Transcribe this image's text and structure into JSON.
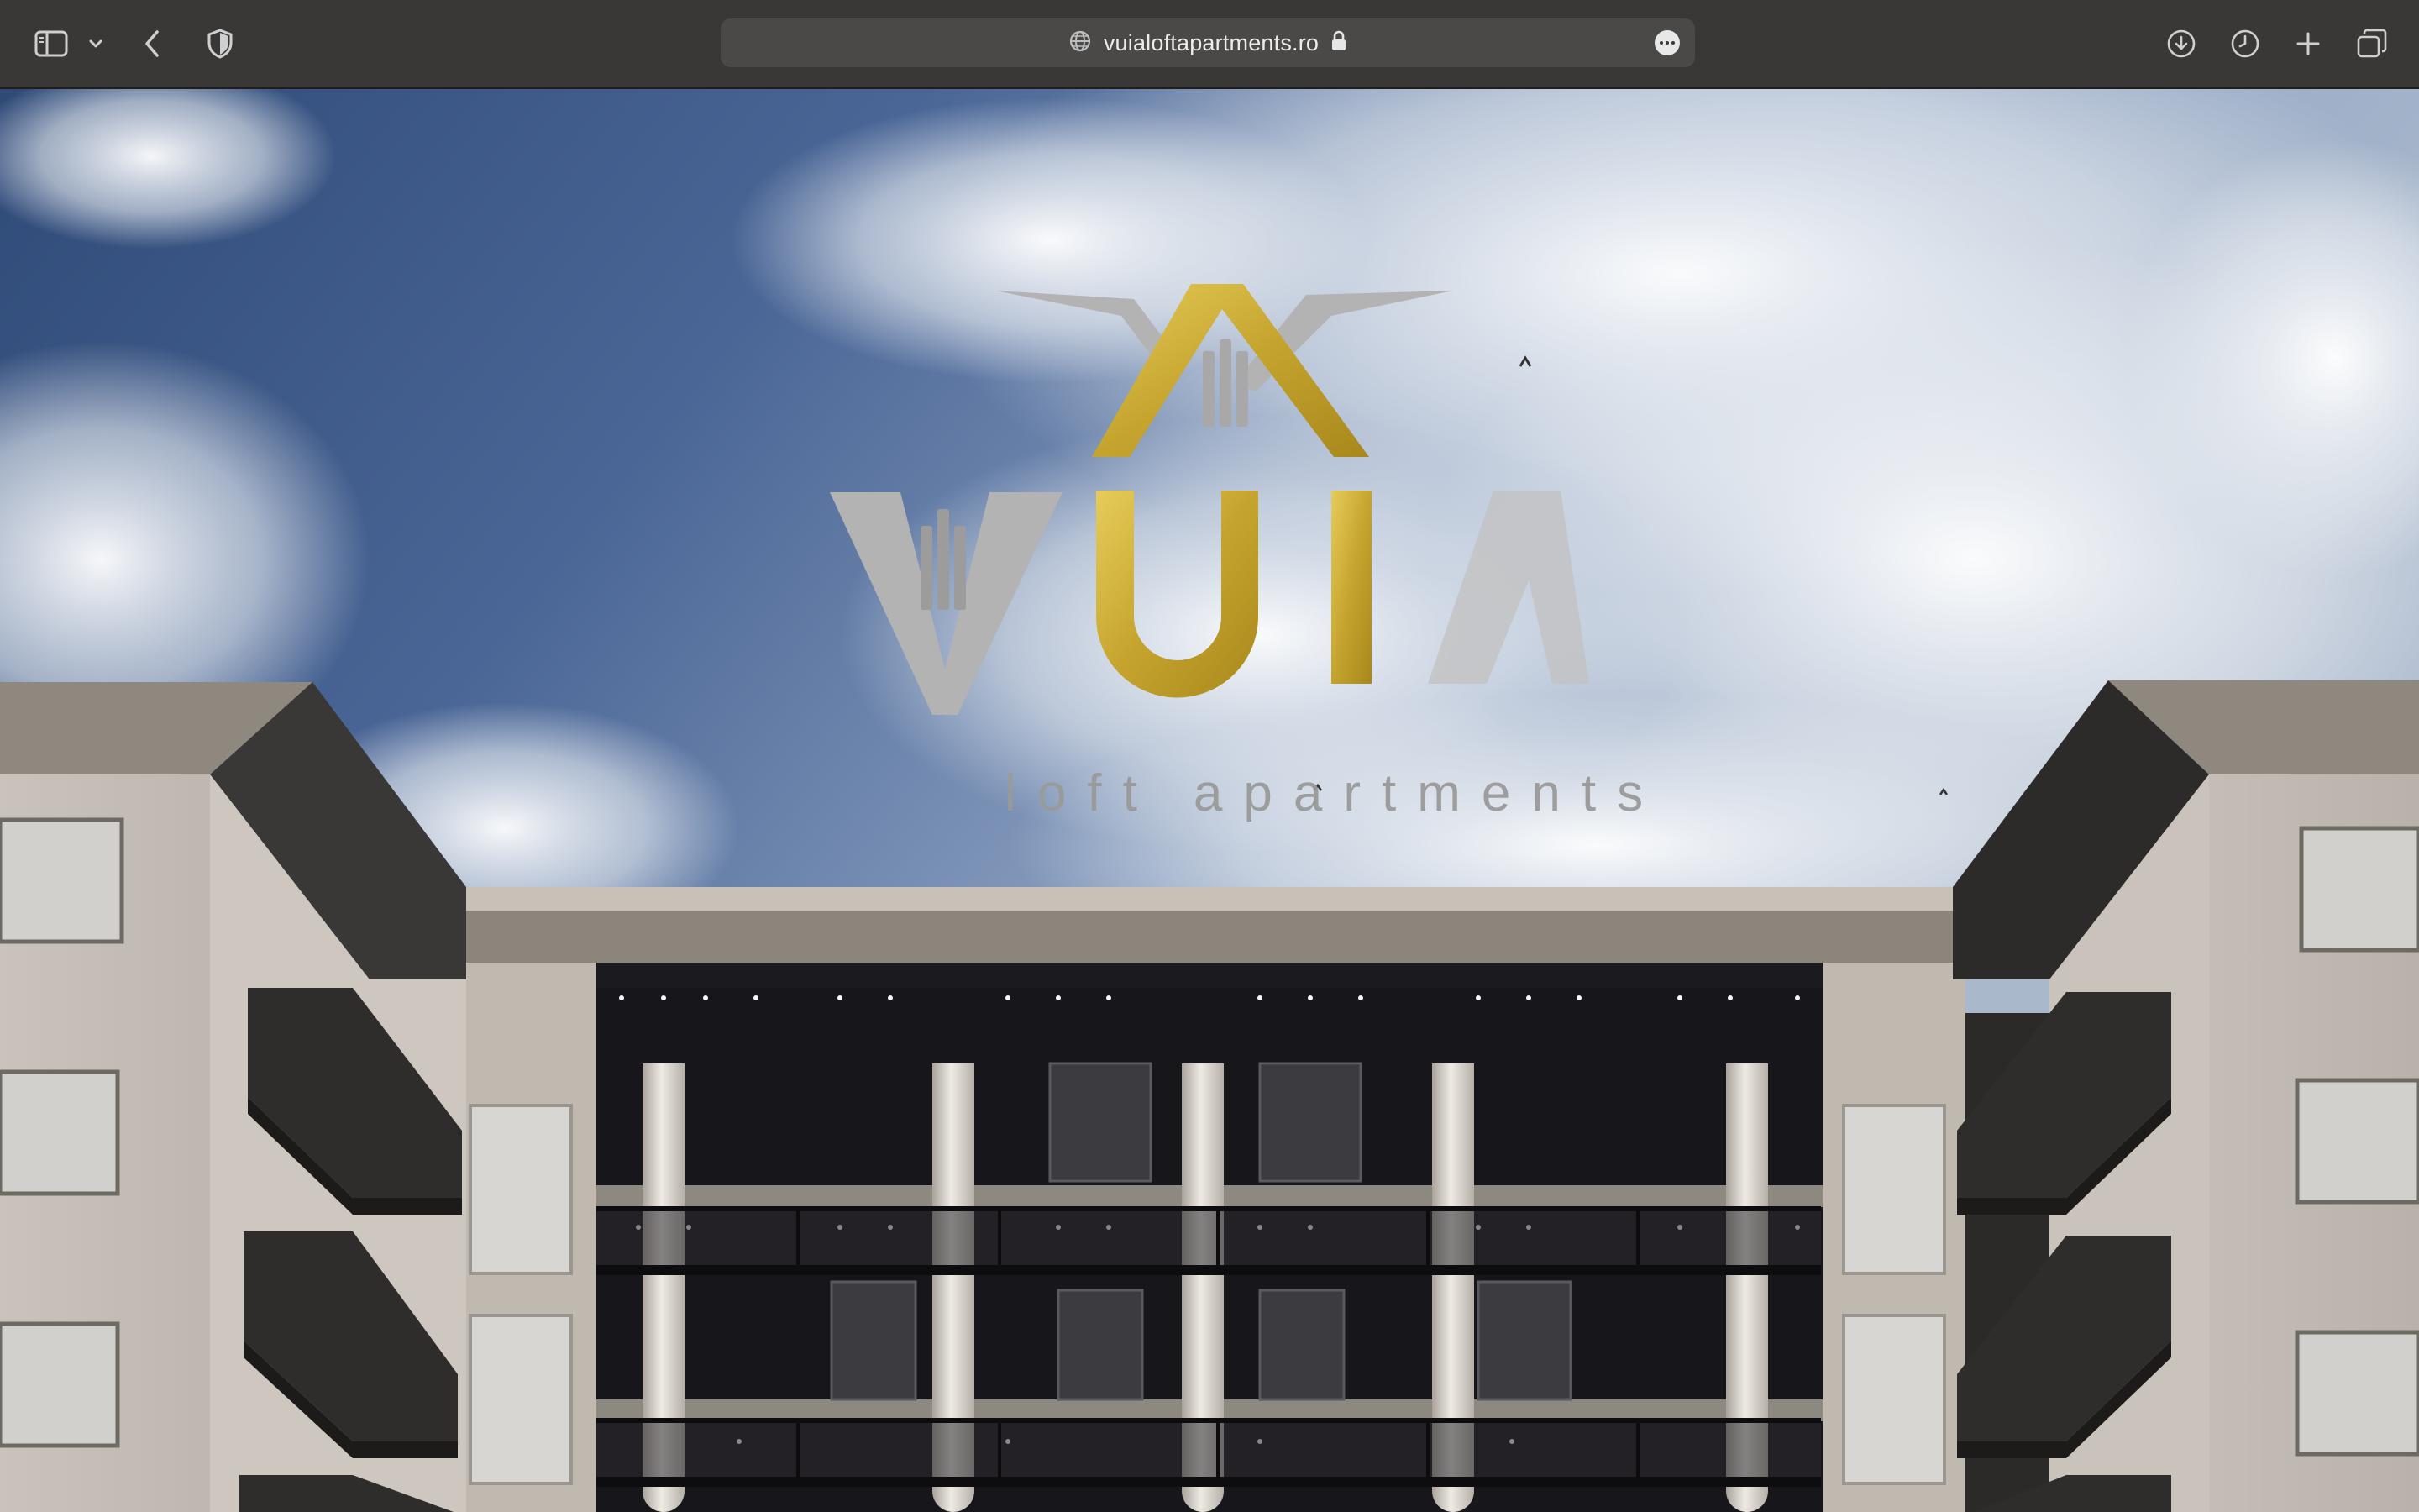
{
  "browser": {
    "url": "vuialoftapartments.ro",
    "icons": {
      "sidebar": "sidebar-icon",
      "dropdown": "chevron-down-icon",
      "back": "chevron-left-icon",
      "privacy": "shield-icon",
      "site": "globe-icon",
      "secure": "lock-icon",
      "more": "ellipsis-icon",
      "downloads": "download-icon",
      "history": "clock-icon",
      "new_tab": "plus-icon",
      "tab_overview": "tabs-icon"
    }
  },
  "page": {
    "logo": {
      "letters": "VUIA",
      "tagline": "loft apartments",
      "colors": {
        "gold": "#c9a834",
        "silver": "#b3b3b3"
      }
    }
  }
}
